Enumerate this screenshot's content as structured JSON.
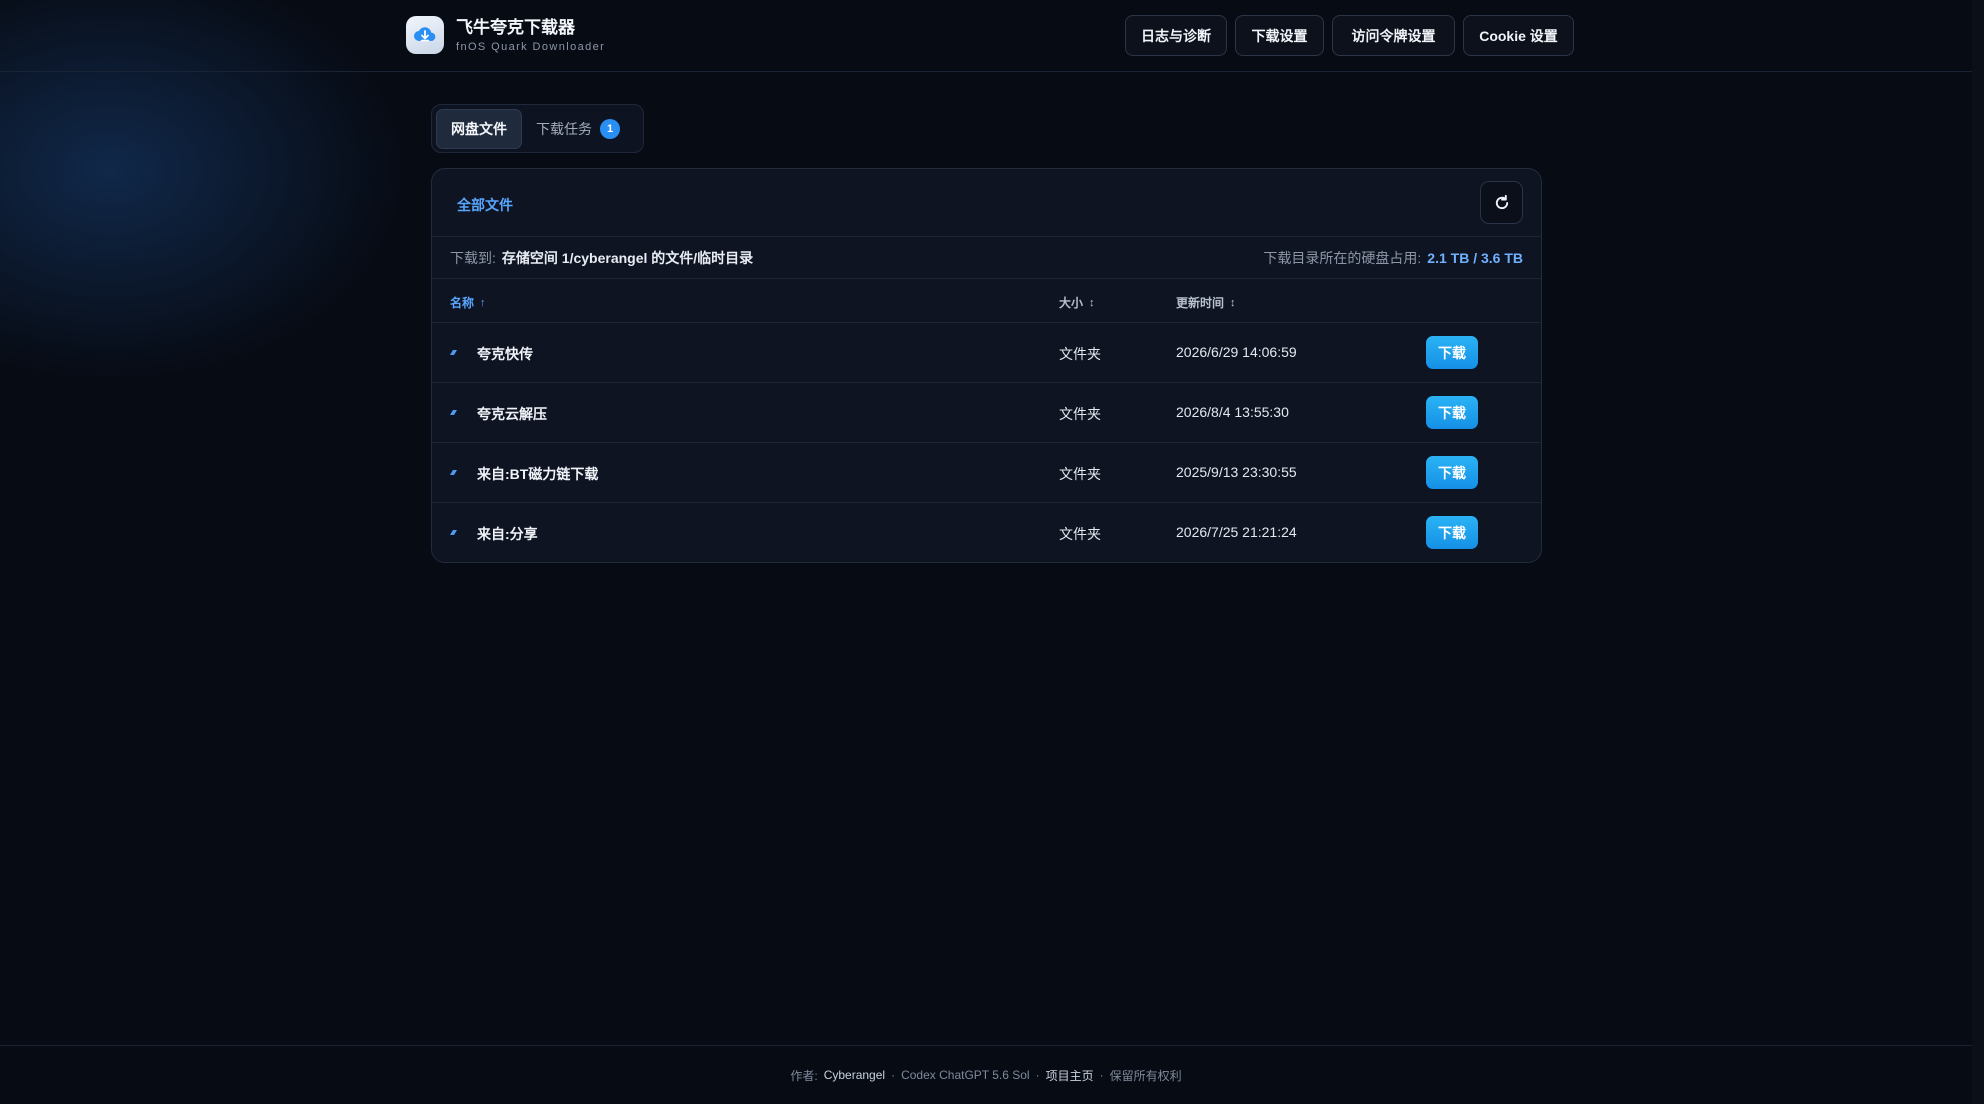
{
  "brand": {
    "title": "飞牛夸克下载器",
    "subtitle": "fnOS Quark Downloader"
  },
  "nav": {
    "logs": "日志与诊断",
    "download_settings": "下载设置",
    "token_settings": "访问令牌设置",
    "cookie_settings": "Cookie 设置"
  },
  "tabs": {
    "files": "网盘文件",
    "tasks": "下载任务",
    "tasks_count": "1"
  },
  "card": {
    "breadcrumb": "全部文件",
    "download_to_label": "下载到:",
    "download_path": "存储空间 1/cyberangel 的文件/临时目录",
    "disk_usage_label": "下载目录所在的硬盘占用:",
    "disk_usage_value": "2.1 TB / 3.6 TB"
  },
  "table": {
    "headers": {
      "name": "名称",
      "size": "大小",
      "time": "更新时间"
    },
    "sort_icons": {
      "name": "↑",
      "size": "↕",
      "time": "↕"
    },
    "rows": [
      {
        "name": "夸克快传",
        "size": "文件夹",
        "time": "2026/6/29 14:06:59",
        "action": "下载"
      },
      {
        "name": "夸克云解压",
        "size": "文件夹",
        "time": "2026/8/4 13:55:30",
        "action": "下载"
      },
      {
        "name": "来自:BT磁力链下载",
        "size": "文件夹",
        "time": "2025/9/13 23:30:55",
        "action": "下载"
      },
      {
        "name": "来自:分享",
        "size": "文件夹",
        "time": "2026/7/25 21:21:24",
        "action": "下载"
      }
    ]
  },
  "footer": {
    "author_label": "作者:",
    "author": "Cyberangel",
    "sep": "·",
    "credit": "Codex ChatGPT 5.6 Sol",
    "homepage": "项目主页",
    "rights": "保留所有权利"
  },
  "colors": {
    "accent": "#58a6ff",
    "button": "#1c9ff0",
    "background": "#070b14"
  }
}
